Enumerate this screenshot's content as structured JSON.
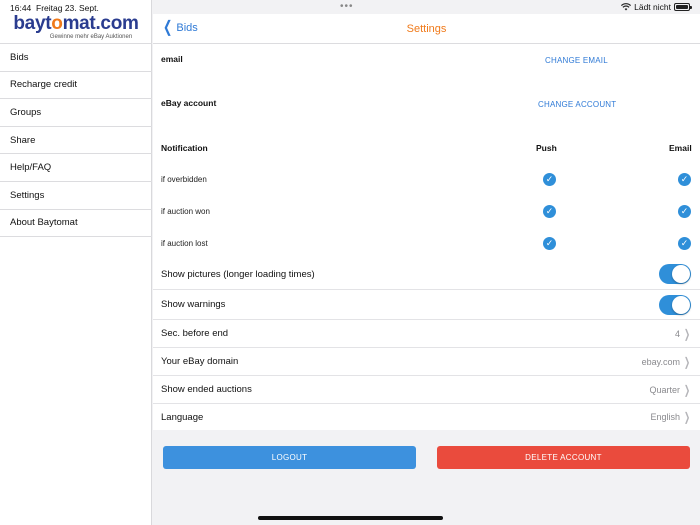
{
  "status": {
    "time": "16:44",
    "date": "Freitag 23. Sept.",
    "charging": "Lädt nicht"
  },
  "sidebar": {
    "brand_part1": "bayt",
    "brand_accent": "o",
    "brand_part2": "mat.com",
    "tagline": "Gewinne mehr eBay Auktionen",
    "items": [
      {
        "label": "Bids"
      },
      {
        "label": "Recharge credit"
      },
      {
        "label": "Groups"
      },
      {
        "label": "Share"
      },
      {
        "label": "Help/FAQ"
      },
      {
        "label": "Settings"
      },
      {
        "label": "About Baytomat"
      }
    ]
  },
  "nav": {
    "back_label": "Bids",
    "title": "Settings"
  },
  "account": {
    "email_label": "email",
    "change_email": "CHANGE EMAIL",
    "ebay_label": "eBay account",
    "change_account": "CHANGE ACCOUNT"
  },
  "notification": {
    "header": "Notification",
    "push_header": "Push",
    "email_header": "Email",
    "rows": [
      {
        "label": "if overbidden"
      },
      {
        "label": "if auction won"
      },
      {
        "label": "if auction lost"
      }
    ]
  },
  "settings": {
    "show_pictures": "Show pictures (longer loading times)",
    "show_warnings": "Show warnings",
    "sec_before_end": "Sec. before end",
    "sec_before_end_value": "4",
    "ebay_domain": "Your eBay domain",
    "ebay_domain_value": "ebay.com",
    "show_ended": "Show ended auctions",
    "show_ended_value": "Quarter",
    "language": "Language",
    "language_value": "English"
  },
  "buttons": {
    "logout": "LOGOUT",
    "delete": "DELETE ACCOUNT"
  },
  "colors": {
    "accent_orange": "#f07a1a",
    "link_blue": "#2f7ad6",
    "logout_blue": "#3d91de",
    "delete_red": "#ea4b3d"
  }
}
